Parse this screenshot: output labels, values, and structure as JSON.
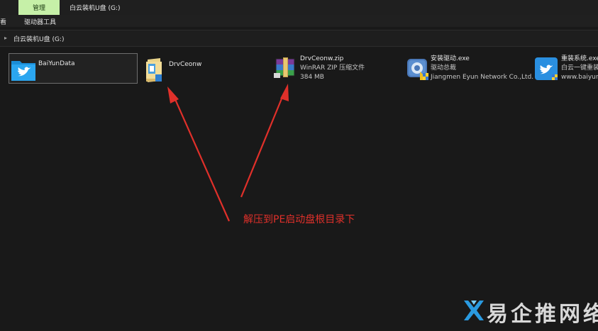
{
  "ribbon": {
    "manage_tab": "管理",
    "window_title": "白云装机U盘 (G:)",
    "view_tab": "查看",
    "drive_tools_tab": "驱动器工具"
  },
  "addressbar": {
    "path": "白云装机U盘 (G:)"
  },
  "files": [
    {
      "name": "BaiYunData",
      "icon": "folder-icon"
    },
    {
      "name": "DrvCeonw",
      "icon": "folder-icon"
    },
    {
      "name": "DrvCeonw.zip",
      "type": "WinRAR ZIP 压缩文件",
      "size": "384 MB",
      "icon": "winrar-icon"
    },
    {
      "name": "安装驱动.exe",
      "description": "驱动总裁",
      "company": "Jiangmen Eyun Network Co.,Ltd.",
      "icon": "driver-app-icon"
    },
    {
      "name": "重装系统.exe",
      "description": "白云一键重装",
      "company": "www.baiyun",
      "icon": "baiyun-app-icon"
    }
  ],
  "annotation": "解压到PE启动盘根目录下",
  "watermark": "易企推网络",
  "colors": {
    "accent": "#c6f0a8",
    "annotation": "#e0302a"
  }
}
